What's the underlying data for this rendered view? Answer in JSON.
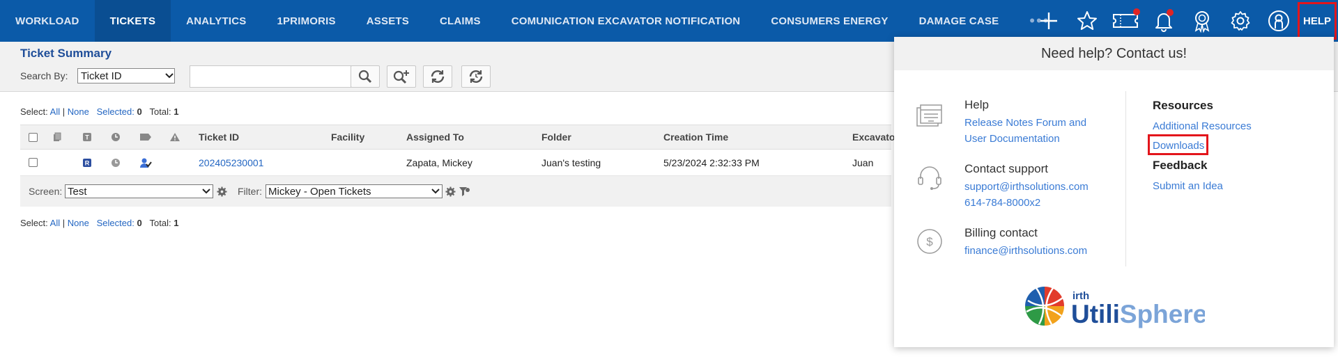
{
  "nav": {
    "tabs": [
      "WORKLOAD",
      "TICKETS",
      "ANALYTICS",
      "1PRIMORIS",
      "ASSETS",
      "CLAIMS",
      "COMUNICATION EXCAVATOR NOTIFICATION",
      "CONSUMERS ENERGY",
      "DAMAGE CASE"
    ],
    "active_tab": "TICKETS",
    "more": "•••",
    "help_label": "HELP",
    "icons": [
      "plus-icon",
      "star-icon",
      "ticket-icon",
      "bell-icon",
      "award-icon",
      "gear-icon",
      "user-icon"
    ]
  },
  "toolbar": {
    "title": "Ticket Summary",
    "search_by_label": "Search By:",
    "search_by_value": "Ticket ID",
    "search_value": ""
  },
  "selection": {
    "label": "Select:",
    "all": "All",
    "none": "None",
    "selected_label": "Selected:",
    "selected_count": "0",
    "total_label": "Total:",
    "total_count": "1"
  },
  "grid": {
    "columns": [
      "Ticket ID",
      "Facility",
      "Assigned To",
      "Folder",
      "Creation Time",
      "Excavato"
    ],
    "rows": [
      {
        "ticket_id": "202405230001",
        "facility": "",
        "assigned_to": "Zapata, Mickey",
        "folder": "Juan's testing",
        "creation_time": "5/23/2024 2:32:33 PM",
        "excavator": "Juan",
        "type_badge": "R"
      }
    ],
    "screen_label": "Screen:",
    "screen_value": "Test",
    "filter_label": "Filter:",
    "filter_value": "Mickey - Open Tickets"
  },
  "help_panel": {
    "title": "Need help? Contact us!",
    "help": {
      "heading": "Help",
      "link": "Release Notes Forum and User Documentation",
      "link_line1": "Release Notes Forum and",
      "link_line2": "User Documentation"
    },
    "support": {
      "heading": "Contact support",
      "email": "support@irthsolutions.com",
      "phone": "614-784-8000x2"
    },
    "billing": {
      "heading": "Billing contact",
      "email": "finance@irthsolutions.com"
    },
    "resources": {
      "heading": "Resources",
      "additional": "Additional Resources",
      "downloads": "Downloads"
    },
    "feedback": {
      "heading": "Feedback",
      "link": "Submit an Idea"
    },
    "logo": {
      "small": "irth",
      "part1": "Utili",
      "part2": "Sphere"
    }
  },
  "colors": {
    "nav_bg": "#0b5aa8",
    "link": "#2366c2",
    "highlight": "#e3151b"
  }
}
